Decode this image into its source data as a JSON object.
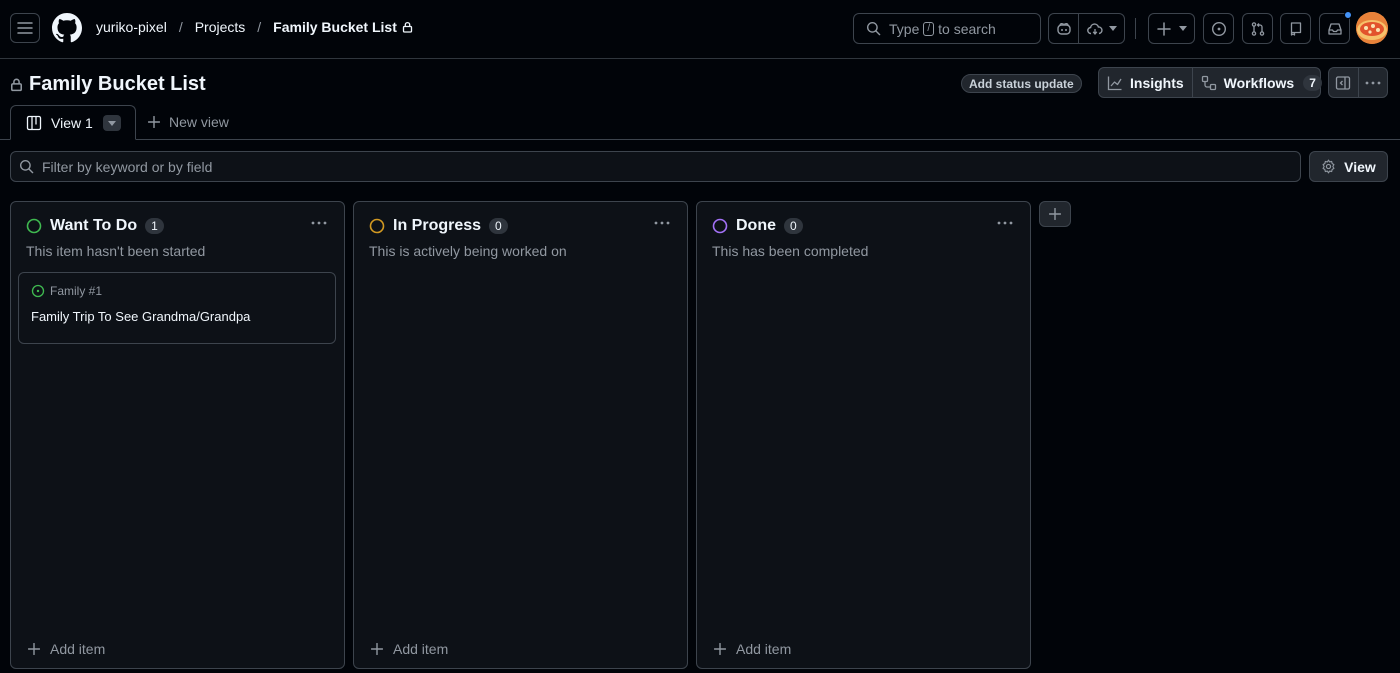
{
  "header": {
    "owner": "yuriko-pixel",
    "section": "Projects",
    "project": "Family Bucket List",
    "search_prefix": "Type",
    "search_key": "/",
    "search_suffix": "to search"
  },
  "project": {
    "title": "Family Bucket List",
    "status_update": "Add status update",
    "insights": "Insights",
    "workflows": "Workflows",
    "workflows_count": "7"
  },
  "tabs": {
    "active": "View 1",
    "new_view": "New view"
  },
  "filter": {
    "placeholder": "Filter by keyword or by field",
    "view_button": "View"
  },
  "columns": [
    {
      "name": "Want To Do",
      "count": "1",
      "description": "This item hasn't been started",
      "color": "#3fb950",
      "add_item": "Add item",
      "cards": [
        {
          "meta": "Family #1",
          "title": "Family Trip To See Grandma/Grandpa"
        }
      ]
    },
    {
      "name": "In Progress",
      "count": "0",
      "description": "This is actively being worked on",
      "color": "#d29922",
      "add_item": "Add item"
    },
    {
      "name": "Done",
      "count": "0",
      "description": "This has been completed",
      "color": "#a371f7",
      "add_item": "Add item"
    }
  ],
  "colors": {
    "background": "#010409",
    "panel": "#0d1117",
    "border": "#3d444d",
    "text": "#f0f6fc",
    "muted": "#9198a1",
    "notification": "#4493f8"
  }
}
